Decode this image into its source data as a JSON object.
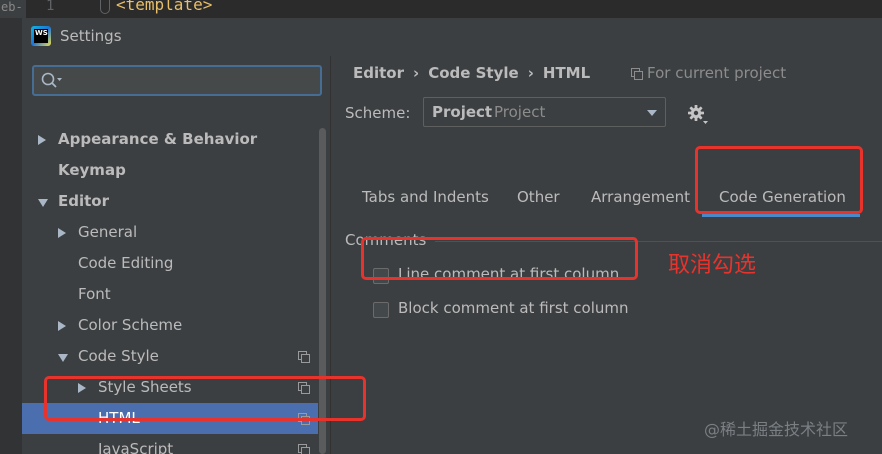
{
  "editor": {
    "tab_fragment": "eb-c",
    "line_number": "1",
    "code_line": "<template>"
  },
  "window": {
    "title": "Settings",
    "app_icon": "webstorm-logo"
  },
  "search": {
    "value": "",
    "placeholder": "",
    "icon": "search-icon"
  },
  "tree": [
    {
      "label": "Appearance & Behavior",
      "indent": 0,
      "arrow": "right",
      "bold": true,
      "copy": false,
      "selected": false
    },
    {
      "label": "Keymap",
      "indent": 0,
      "arrow": "none",
      "bold": true,
      "copy": false,
      "selected": false
    },
    {
      "label": "Editor",
      "indent": 0,
      "arrow": "down",
      "bold": true,
      "copy": false,
      "selected": false
    },
    {
      "label": "General",
      "indent": 1,
      "arrow": "right",
      "bold": false,
      "copy": false,
      "selected": false
    },
    {
      "label": "Code Editing",
      "indent": 1,
      "arrow": "none",
      "bold": false,
      "copy": false,
      "selected": false
    },
    {
      "label": "Font",
      "indent": 1,
      "arrow": "none",
      "bold": false,
      "copy": false,
      "selected": false
    },
    {
      "label": "Color Scheme",
      "indent": 1,
      "arrow": "right",
      "bold": false,
      "copy": false,
      "selected": false
    },
    {
      "label": "Code Style",
      "indent": 1,
      "arrow": "down",
      "bold": false,
      "copy": true,
      "selected": false
    },
    {
      "label": "Style Sheets",
      "indent": 2,
      "arrow": "right",
      "bold": false,
      "copy": true,
      "selected": false
    },
    {
      "label": "HTML",
      "indent": 2,
      "arrow": "none",
      "bold": false,
      "copy": true,
      "selected": true
    },
    {
      "label": "JavaScript",
      "indent": 2,
      "arrow": "none",
      "bold": false,
      "copy": true,
      "selected": false
    }
  ],
  "breadcrumb": [
    "Editor",
    "Code Style",
    "HTML"
  ],
  "breadcrumb_separator": "›",
  "for_current_project": "For current project",
  "scheme": {
    "label": "Scheme:",
    "value": "Project",
    "kind": "Project"
  },
  "tabs": [
    {
      "label": "Tabs and Indents",
      "active": false
    },
    {
      "label": "Other",
      "active": false
    },
    {
      "label": "Arrangement",
      "active": false
    },
    {
      "label": "Code Generation",
      "active": true
    }
  ],
  "comments_section": {
    "title": "Comments",
    "options": [
      {
        "label": "Line comment at first column",
        "checked": false
      },
      {
        "label": "Block comment at first column",
        "checked": false
      }
    ]
  },
  "annotation": {
    "text": "取消勾选",
    "color": "#e8332d"
  },
  "watermark": "@稀土掘金技术社区",
  "colors": {
    "selection": "#4b6eaf",
    "tab_underline": "#4a88c7",
    "background": "#3c3f41"
  }
}
